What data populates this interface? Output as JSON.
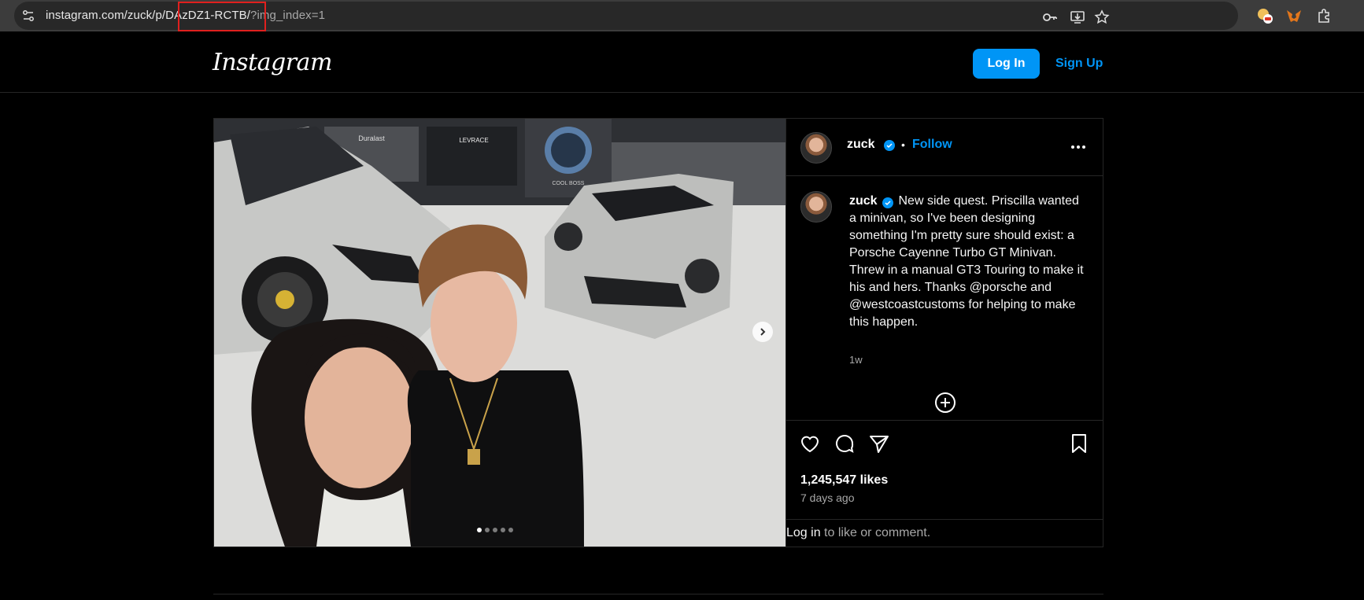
{
  "browser": {
    "url_host": "instagram.com/zuck/p/",
    "url_post_id": "DAzDZ1-RCTB/",
    "url_query": "?img_index=1",
    "icons": [
      "site-info-icon",
      "key-icon",
      "install-icon",
      "star-icon",
      "extension-adblock-icon",
      "metamask-icon",
      "puzzle-icon"
    ]
  },
  "header": {
    "logo": "Instagram",
    "login_label": "Log In",
    "signup_label": "Sign Up"
  },
  "post": {
    "username": "zuck",
    "follow_label": "Follow",
    "separator": "•",
    "caption_user": "zuck",
    "caption_text": "New side quest. Priscilla wanted a minivan, so I've been designing something I'm pretty sure should exist: a Porsche Cayenne Turbo GT Minivan. Threw in a manual GT3 Touring to make it his and hers. Thanks @porsche and @westcoastcustoms for helping to make this happen.",
    "caption_time": "1w",
    "likes": "1,245,547 likes",
    "date": "7 days ago",
    "login_link": "Log in",
    "login_rest": " to like or comment.",
    "carousel_count": 5,
    "carousel_active": 1,
    "garage_signs": [
      "Duralast",
      "LEVRACE",
      "COOL BOSS"
    ]
  },
  "colors": {
    "accent": "#0095f6",
    "background": "#000000",
    "highlight": "#e0201e"
  }
}
